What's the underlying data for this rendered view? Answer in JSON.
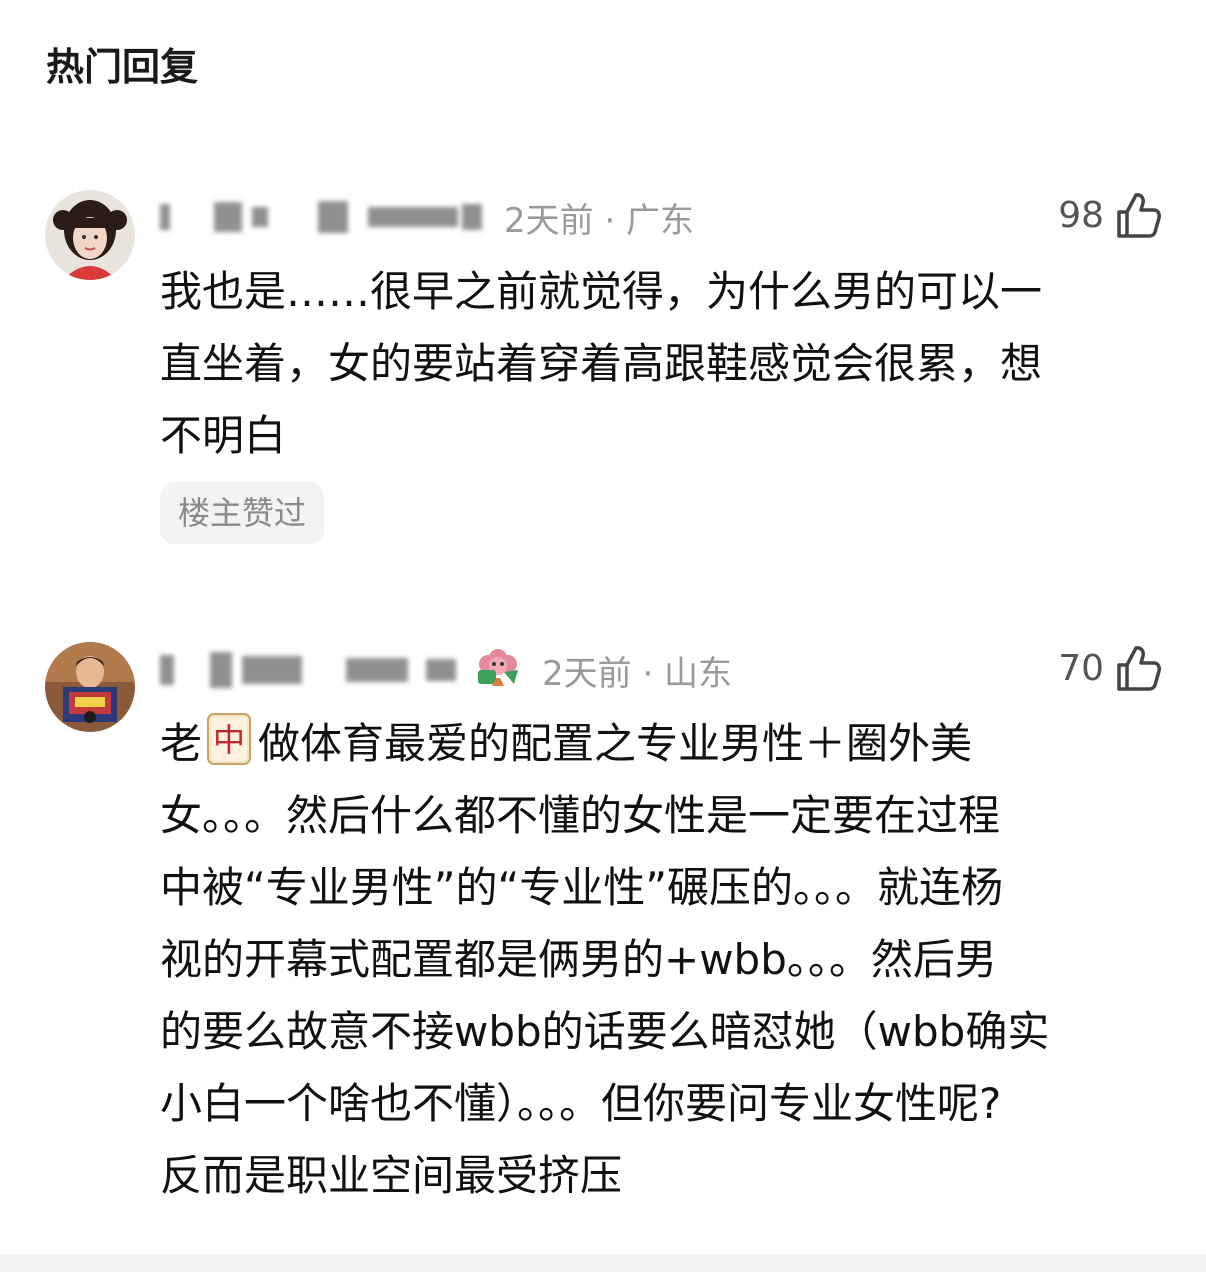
{
  "section": {
    "title": "热门回复"
  },
  "comments": [
    {
      "meta": "2天前 · 广东",
      "likes": "98",
      "text_lines": [
        "我也是……很早之前就觉得，为什么男的可以一",
        "直坐着，女的要站着穿着高跟鞋感觉会很累，想",
        "不明白"
      ],
      "badge": "楼主赞过"
    },
    {
      "meta": "2天前 · 山东",
      "likes": "70",
      "first_line_prefix": "老",
      "first_line_suffix": "做体育最爱的配置之专业男性＋圈外美",
      "mahjong_char": "中",
      "text_lines": [
        "女。。。然后什么都不懂的女性是一定要在过程",
        "中被“专业男性”的“专业性”碾压的。。。就连杨",
        "视的开幕式配置都是俩男的+wbb。。。然后男",
        "的要么故意不接wbb的话要么暗怼她（wbb确实",
        "小白一个啥也不懂）。。。但你要问专业女性呢?",
        "反而是职业空间最受挤压"
      ]
    }
  ],
  "icons": {
    "like": "thumbs-up-icon",
    "sticker": "flower-sticker-icon",
    "mahjong": "mahjong-red-dragon-icon"
  },
  "colors": {
    "meta_gray": "#9a9a9a",
    "badge_bg": "#f3f3f3",
    "mahjong_red": "#c0282d"
  }
}
